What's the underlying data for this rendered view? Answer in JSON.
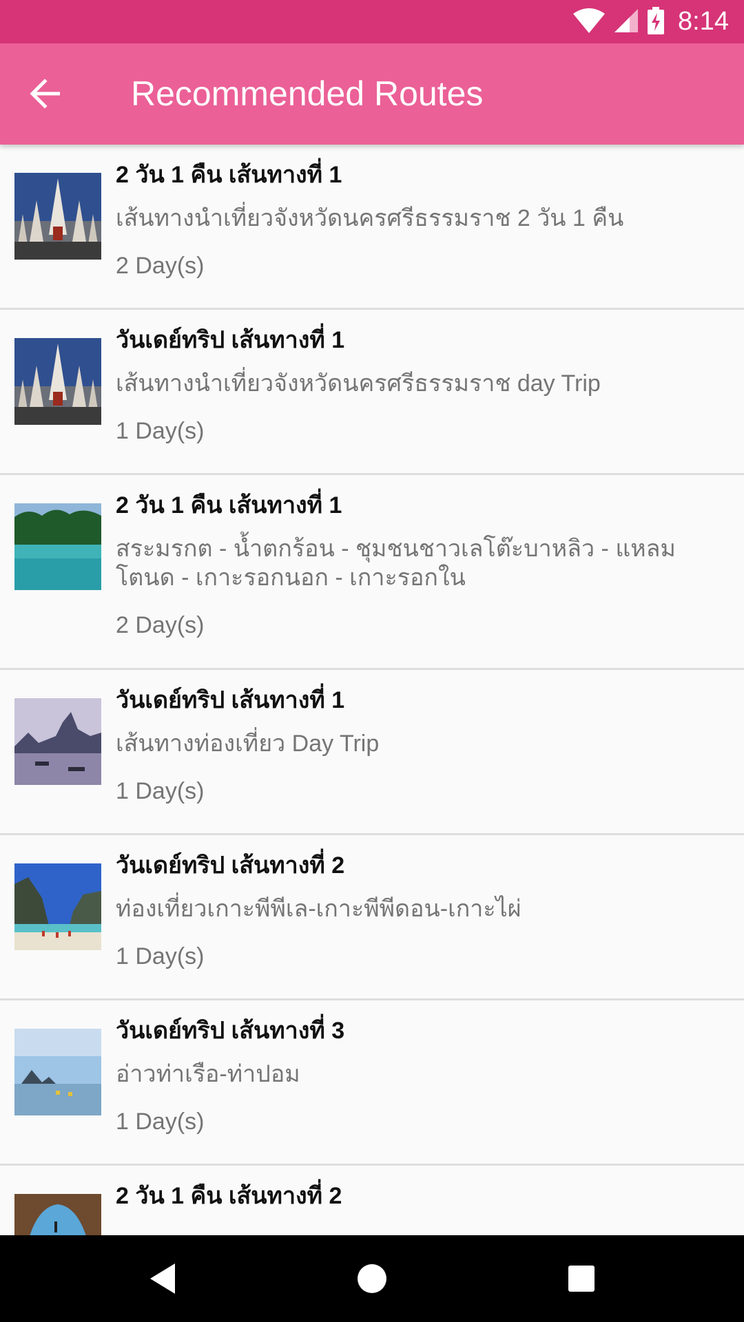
{
  "status_bar": {
    "time": "8:14",
    "icons": [
      "wifi-icon",
      "signal-icon",
      "battery-charging-icon"
    ]
  },
  "app_bar": {
    "title": "Recommended Routes",
    "back_icon": "arrow-back-icon"
  },
  "routes": [
    {
      "title": "2 วัน 1 คืน เส้นทางที่ 1",
      "description": "เส้นทางนำเที่ยวจังหวัดนครศรีธรรมราช 2 วัน 1 คืน",
      "duration": "2 Day(s)",
      "image": "pagoda-photo"
    },
    {
      "title": "วันเดย์ทริป เส้นทางที่ 1",
      "description": "เส้นทางนำเที่ยวจังหวัดนครศรีธรรมราช day Trip",
      "duration": "1 Day(s)",
      "image": "pagoda-photo"
    },
    {
      "title": "2 วัน 1 คืน เส้นทางที่ 1",
      "description": "สระมรกต - น้ำตกร้อน - ชุมชนชาวเลโต๊ะบาหลิว - แหลมโตนด - เกาะรอกนอก - เกาะรอกใน",
      "duration": "2 Day(s)",
      "image": "emerald-pool-photo"
    },
    {
      "title": "วันเดย์ทริป เส้นทางที่ 1",
      "description": "เส้นทางท่องเที่ยว Day Trip",
      "duration": "1 Day(s)",
      "image": "limestone-bay-photo"
    },
    {
      "title": "วันเดย์ทริป เส้นทางที่ 2",
      "description": "ท่องเที่ยวเกาะพีพีเล-เกาะพีพีดอน-เกาะไผ่",
      "duration": "1 Day(s)",
      "image": "beach-cliffs-photo"
    },
    {
      "title": "วันเดย์ทริป เส้นทางที่ 3",
      "description": "อ่าวท่าเรือ-ท่าปอม",
      "duration": "1 Day(s)",
      "image": "calm-sea-photo"
    },
    {
      "title": "2 วัน 1 คืน เส้นทางที่ 2",
      "description": "",
      "duration": "",
      "image": "cave-arch-photo"
    }
  ],
  "nav_bar": {
    "icons": [
      "back-triangle-icon",
      "home-circle-icon",
      "recents-square-icon"
    ]
  },
  "colors": {
    "status_bar": "#d63477",
    "app_bar": "#eb6097"
  }
}
